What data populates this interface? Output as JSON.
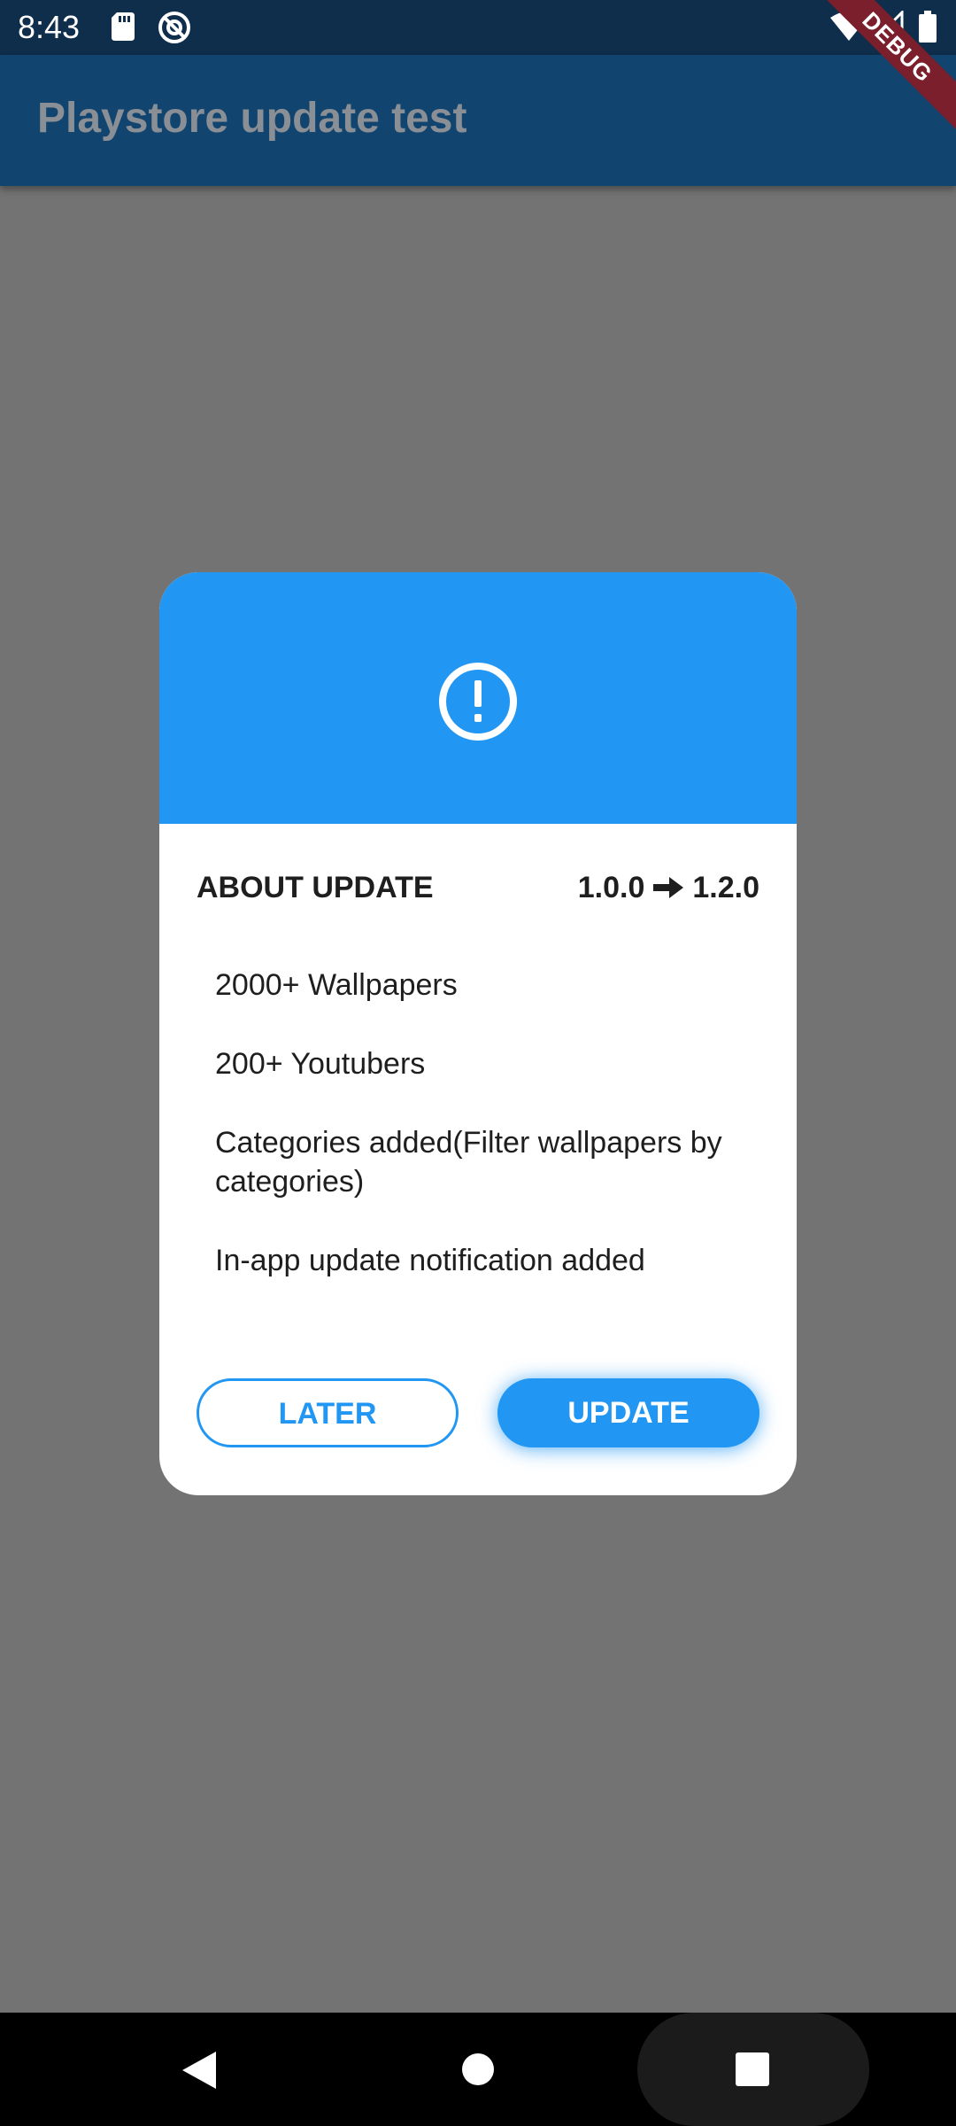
{
  "status_bar": {
    "time": "8:43",
    "icons": [
      "sd-card-icon",
      "at-sign-icon",
      "wifi-icon",
      "signal-icon",
      "battery-icon"
    ]
  },
  "debug_banner": {
    "label": "DEBUG",
    "color": "#7a1f2b"
  },
  "app_bar": {
    "title": "Playstore update test",
    "color": "#114570"
  },
  "dialog": {
    "header_color": "#2196f3",
    "header_icon": "alert-circle-icon",
    "title": "ABOUT UPDATE",
    "version_from": "1.0.0",
    "version_to": "1.2.0",
    "changes": [
      "2000+ Wallpapers",
      "200+ Youtubers",
      "Categories added(Filter wallpapers by categories)",
      "In-app update notification added"
    ],
    "buttons": {
      "later": "LATER",
      "update": "UPDATE"
    },
    "accent_color": "#2196f3"
  },
  "nav_bar": {
    "icons": [
      "back-icon",
      "home-icon",
      "recents-icon"
    ]
  }
}
